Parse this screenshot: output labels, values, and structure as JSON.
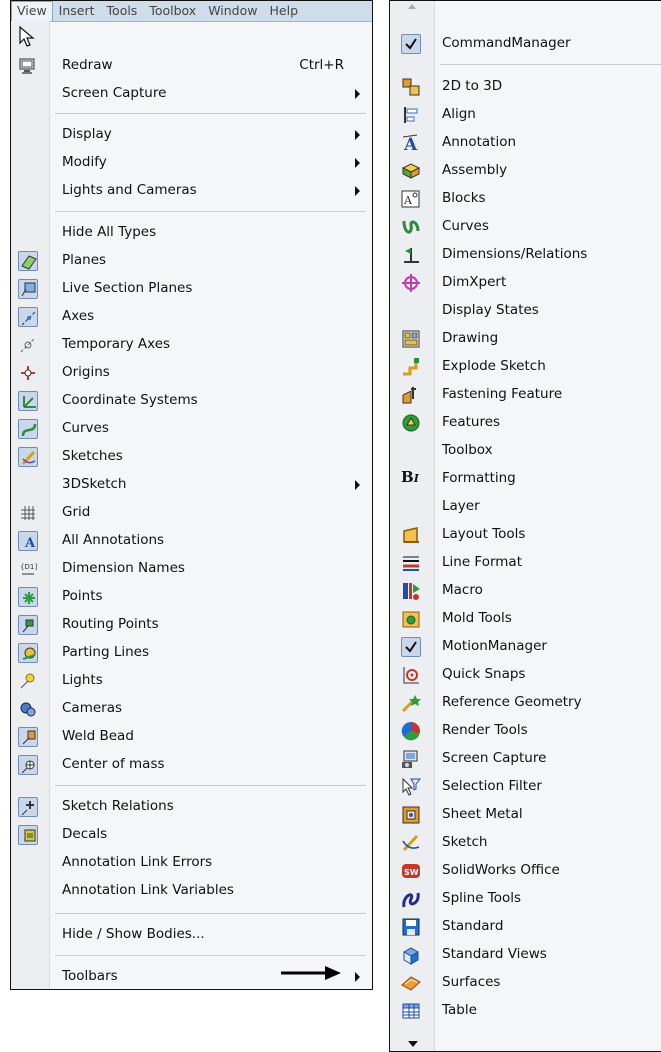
{
  "menubar": {
    "items": [
      "View",
      "Insert",
      "Tools",
      "Toolbox",
      "Window",
      "Help"
    ]
  },
  "view_menu": {
    "redraw": {
      "label": "Redraw",
      "shortcut": "Ctrl+R"
    },
    "screen_capture": "Screen Capture",
    "display": "Display",
    "modify": "Modify",
    "lights_and_cameras": "Lights and Cameras",
    "hide_all_types": "Hide All Types",
    "planes": "Planes",
    "live_section_planes": "Live Section Planes",
    "axes": "Axes",
    "temporary_axes": "Temporary Axes",
    "origins": "Origins",
    "coordinate_systems": "Coordinate Systems",
    "curves": "Curves",
    "sketches": "Sketches",
    "sketch_3d": "3DSketch",
    "grid": "Grid",
    "all_annotations": "All Annotations",
    "dimension_names": "Dimension Names",
    "points": "Points",
    "routing_points": "Routing Points",
    "parting_lines": "Parting Lines",
    "lights": "Lights",
    "cameras": "Cameras",
    "weld_bead": "Weld Bead",
    "center_of_mass": "Center of mass",
    "sketch_relations": "Sketch Relations",
    "decals": "Decals",
    "annotation_link_errors": "Annotation Link Errors",
    "annotation_link_variables": "Annotation Link Variables",
    "hide_show_bodies": "Hide / Show Bodies...",
    "toolbars": "Toolbars"
  },
  "toolbars_menu": {
    "command_manager": "CommandManager",
    "items": [
      "2D to 3D",
      "Align",
      "Annotation",
      "Assembly",
      "Blocks",
      "Curves",
      "Dimensions/Relations",
      "DimXpert",
      "Display States",
      "Drawing",
      "Explode Sketch",
      "Fastening Feature",
      "Features",
      "Toolbox",
      "Formatting",
      "Layer",
      "Layout Tools",
      "Line Format",
      "Macro",
      "Mold Tools",
      "MotionManager",
      "Quick Snaps",
      "Reference Geometry",
      "Render Tools",
      "Screen Capture",
      "Selection Filter",
      "Sheet Metal",
      "Sketch",
      "SolidWorks Office",
      "Spline Tools",
      "Standard",
      "Standard Views",
      "Surfaces",
      "Table"
    ]
  },
  "colors": {
    "menu_background": "#f5f6f8",
    "gutter": "#eceef2",
    "menubar": "#cfdce9",
    "checked_box": "#c9d7ea"
  }
}
